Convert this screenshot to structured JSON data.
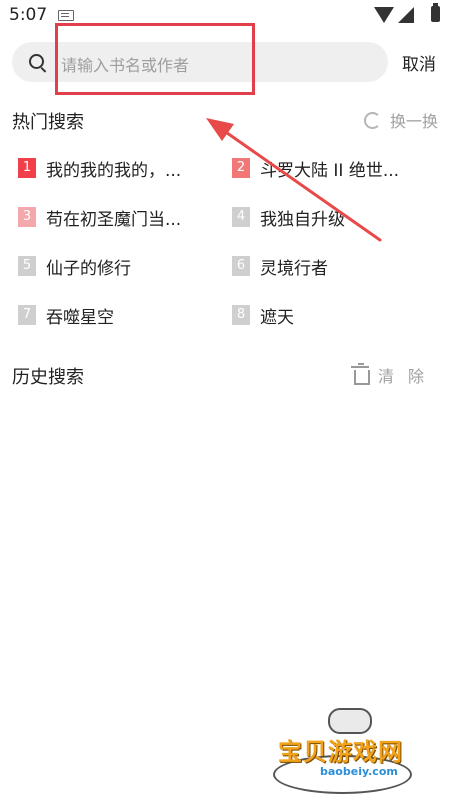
{
  "status_bar": {
    "time": "5:07",
    "icons": [
      "keyboard-icon",
      "wifi-icon",
      "signal-icon",
      "battery-icon"
    ]
  },
  "search": {
    "placeholder": "请输入书名或作者",
    "cancel_label": "取消"
  },
  "hot_search": {
    "title": "热门搜索",
    "refresh_label": "换一换",
    "items": [
      {
        "rank": "1",
        "title": "我的我的我的，...",
        "rank_color": "#f2404a"
      },
      {
        "rank": "2",
        "title": "斗罗大陆 II 绝世...",
        "rank_color": "#f27878"
      },
      {
        "rank": "3",
        "title": "苟在初圣魔门当...",
        "rank_color": "#f5a8ab"
      },
      {
        "rank": "4",
        "title": "我独自升级",
        "rank_color": "#cfcfcf"
      },
      {
        "rank": "5",
        "title": "仙子的修行",
        "rank_color": "#cfcfcf"
      },
      {
        "rank": "6",
        "title": "灵境行者",
        "rank_color": "#cfcfcf"
      },
      {
        "rank": "7",
        "title": "吞噬星空",
        "rank_color": "#cfcfcf"
      },
      {
        "rank": "8",
        "title": "遮天",
        "rank_color": "#cfcfcf"
      }
    ]
  },
  "history_search": {
    "title": "历史搜索",
    "clear_label": "清除"
  },
  "annotation": {
    "color": "#e0404a"
  },
  "watermark": {
    "title": "宝贝游戏网",
    "url": "baobeiy.com"
  }
}
